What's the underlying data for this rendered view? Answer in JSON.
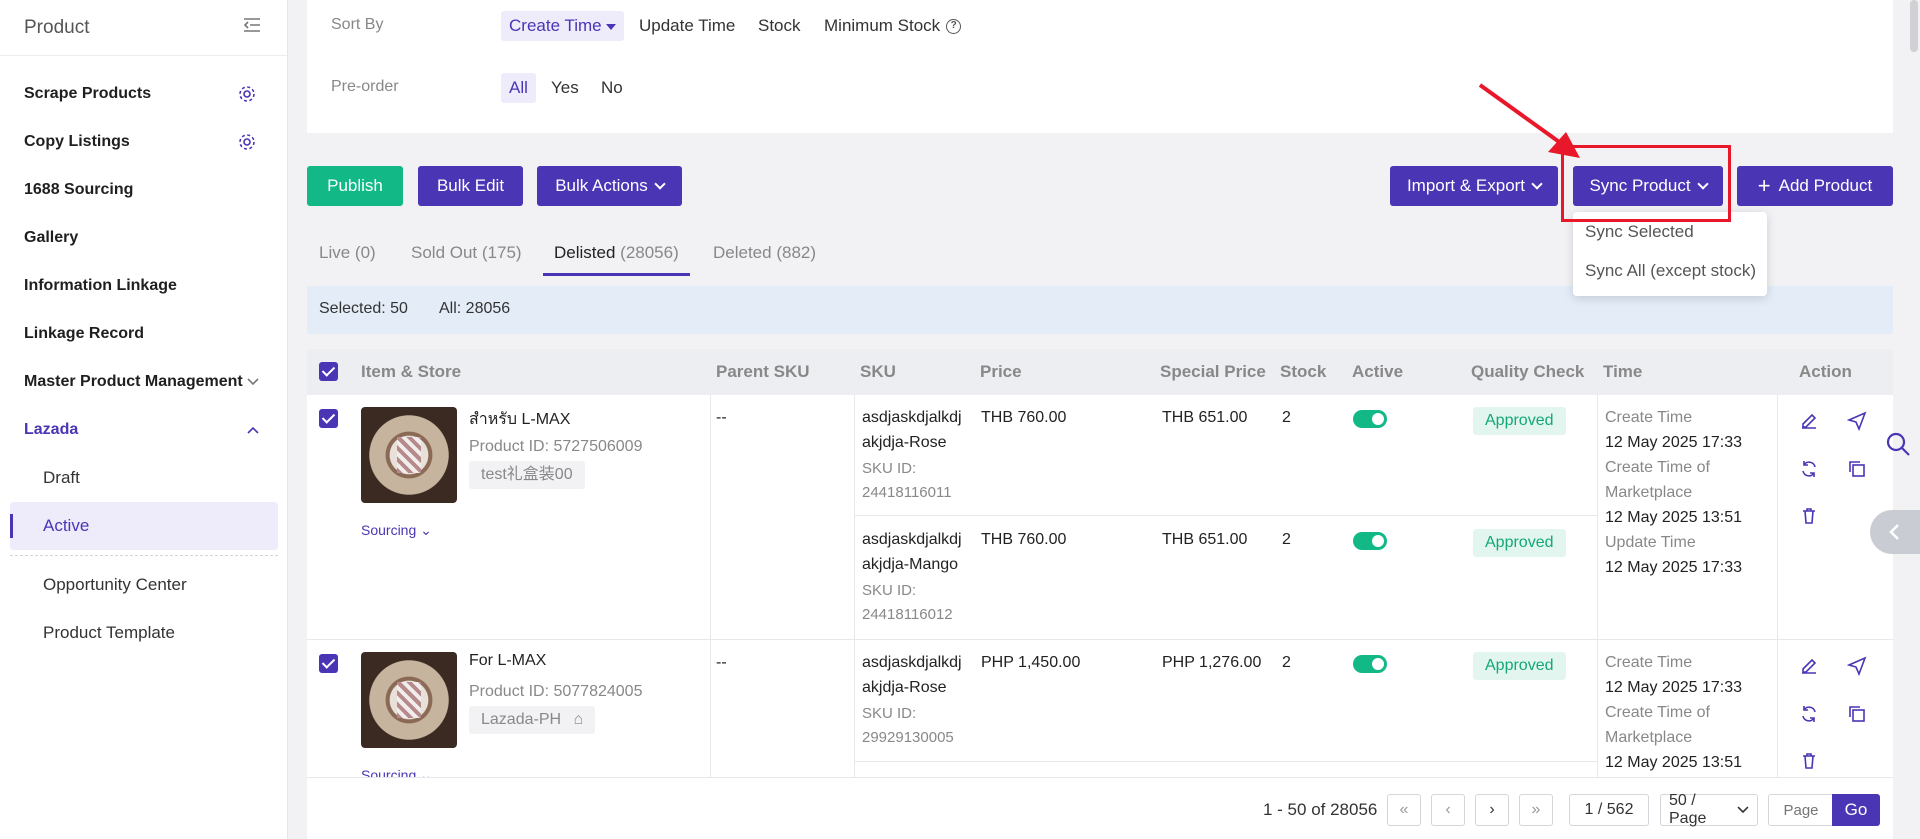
{
  "sidebar": {
    "title": "Product",
    "items": [
      {
        "label": "Scrape Products"
      },
      {
        "label": "Copy Listings"
      },
      {
        "label": "1688 Sourcing"
      },
      {
        "label": "Gallery"
      },
      {
        "label": "Information Linkage"
      },
      {
        "label": "Linkage Record"
      },
      {
        "label": "Master Product Management"
      },
      {
        "label": "Lazada"
      }
    ],
    "lazada_sub": [
      {
        "label": "Draft"
      },
      {
        "label": "Active"
      }
    ],
    "bottom": [
      {
        "label": "Opportunity Center"
      },
      {
        "label": "Product Template"
      }
    ]
  },
  "filters": {
    "sort_label": "Sort By",
    "sort_options": [
      "Create Time",
      "Update Time",
      "Stock",
      "Minimum Stock"
    ],
    "preorder_label": "Pre-order",
    "preorder_options": [
      "All",
      "Yes",
      "No"
    ]
  },
  "toolbar": {
    "publish": "Publish",
    "bulk_edit": "Bulk Edit",
    "bulk_actions": "Bulk Actions",
    "import_export": "Import & Export",
    "sync_product": "Sync Product",
    "add_product": "Add Product"
  },
  "sync_menu": [
    "Sync Selected",
    "Sync All (except stock)"
  ],
  "tabs": [
    {
      "label": "Live",
      "count": "(0)"
    },
    {
      "label": "Sold Out",
      "count": "(175)"
    },
    {
      "label": "Delisted",
      "count": "(28056)"
    },
    {
      "label": "Deleted",
      "count": "(882)"
    }
  ],
  "selection": {
    "selected": "Selected: 50",
    "all": "All: 28056"
  },
  "table": {
    "headers": [
      "Item & Store",
      "Parent SKU",
      "SKU",
      "Price",
      "Special Price",
      "Stock",
      "Active",
      "Quality Check",
      "Time",
      "Action"
    ],
    "rows": [
      {
        "name": "สำหรับ L-MAX",
        "product_id": "Product ID: 5727506009",
        "store": "test礼盒装00",
        "sourcing": "Sourcing",
        "parent_sku": "--",
        "skus": [
          {
            "sku_line1": "asdjaskdjalkdj",
            "sku_line2": "akjdja-Rose",
            "sku_id_label": "SKU ID:",
            "sku_id": "24418116011",
            "price": "THB 760.00",
            "special": "THB 651.00",
            "stock": "2",
            "qc": "Approved"
          },
          {
            "sku_line1": "asdjaskdjalkdj",
            "sku_line2": "akjdja-Mango",
            "sku_id_label": "SKU ID:",
            "sku_id": "24418116012",
            "price": "THB 760.00",
            "special": "THB 651.00",
            "stock": "2",
            "qc": "Approved"
          }
        ],
        "times": [
          "Create Time",
          "12 May 2025 17:33",
          "Create Time of",
          "Marketplace",
          "12 May 2025 13:51",
          "Update Time",
          "12 May 2025 17:33"
        ]
      },
      {
        "name": "For L-MAX",
        "product_id": "Product ID: 5077824005",
        "store": "Lazada-PH",
        "sourcing": "Sourcing",
        "parent_sku": "--",
        "skus": [
          {
            "sku_line1": "asdjaskdjalkdj",
            "sku_line2": "akjdja-Rose",
            "sku_id_label": "SKU ID:",
            "sku_id": "29929130005",
            "price": "PHP 1,450.00",
            "special": "PHP 1,276.00",
            "stock": "2",
            "qc": "Approved"
          }
        ],
        "times": [
          "Create Time",
          "12 May 2025 17:33",
          "Create Time of",
          "Marketplace",
          "12 May 2025 13:51"
        ]
      }
    ]
  },
  "pagination": {
    "summary": "1 - 50 of 28056",
    "page": "1 / 562",
    "page_size": "50 / Page",
    "jump_placeholder": "Page",
    "go": "Go"
  },
  "colors": {
    "accent": "#4a35b5",
    "publish": "#12b886",
    "highlight": "#e8182a"
  }
}
